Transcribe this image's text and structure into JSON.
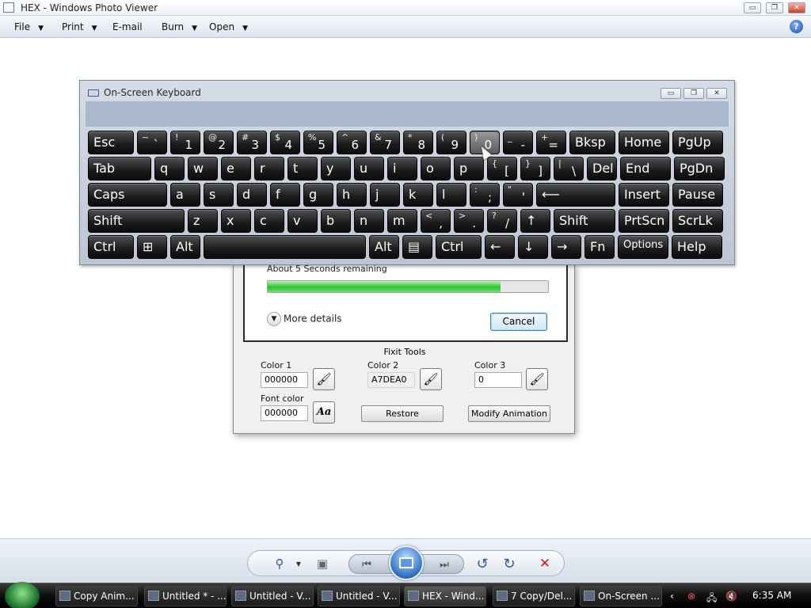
{
  "photo_viewer": {
    "title": "HEX - Windows Photo Viewer",
    "window_buttons": [
      "▭",
      "❐",
      "✕"
    ],
    "menu": [
      {
        "label": "File",
        "has_arrow": true
      },
      {
        "label": "Print",
        "has_arrow": true
      },
      {
        "label": "E-mail",
        "has_arrow": false
      },
      {
        "label": "Burn",
        "has_arrow": true
      },
      {
        "label": "Open",
        "has_arrow": true
      }
    ],
    "help": "?",
    "controls": {
      "zoom_icon": "⚲",
      "actual_size_icon": "▣",
      "prev_icon": "⏮",
      "next_icon": "⏭",
      "rotate_ccw_icon": "↺",
      "rotate_cw_icon": "↻",
      "delete_icon": "✕"
    }
  },
  "progress_dialog": {
    "remaining_text": "About 5 Seconds remaining",
    "progress": 0.83,
    "more_details": "More details",
    "cancel": "Cancel"
  },
  "fixit": {
    "title": "Fixit Tools",
    "color1_label": "Color 1",
    "color1_value": "000000",
    "color2_label": "Color 2",
    "color2_value": "A7DEA0",
    "color3_label": "Color 3",
    "color3_value": "0",
    "font_color_label": "Font color",
    "font_color_value": "000000",
    "font_button": "Aa",
    "restore": "Restore",
    "modify_animation": "Modify Animation"
  },
  "osk": {
    "title": "On-Screen Keyboard",
    "window_buttons": [
      "▭",
      "❐",
      "✕"
    ],
    "rows": [
      [
        {
          "m": "Esc"
        },
        {
          "s": "~",
          "b": "`"
        },
        {
          "s": "!",
          "b": "1"
        },
        {
          "s": "@",
          "b": "2"
        },
        {
          "s": "#",
          "b": "3"
        },
        {
          "s": "$",
          "b": "4"
        },
        {
          "s": "%",
          "b": "5"
        },
        {
          "s": "^",
          "b": "6"
        },
        {
          "s": "&",
          "b": "7"
        },
        {
          "s": "*",
          "b": "8"
        },
        {
          "s": "(",
          "b": "9"
        },
        {
          "s": ")",
          "b": "0",
          "sel": true
        },
        {
          "s": "_",
          "b": "-"
        },
        {
          "s": "+",
          "b": "="
        },
        {
          "m": "Bksp"
        },
        {
          "m": "Home"
        },
        {
          "m": "PgUp"
        }
      ],
      [
        {
          "m": "Tab"
        },
        {
          "m": "q"
        },
        {
          "m": "w"
        },
        {
          "m": "e"
        },
        {
          "m": "r"
        },
        {
          "m": "t"
        },
        {
          "m": "y"
        },
        {
          "m": "u"
        },
        {
          "m": "i"
        },
        {
          "m": "o"
        },
        {
          "m": "p"
        },
        {
          "s": "{",
          "b": "["
        },
        {
          "s": "}",
          "b": "]"
        },
        {
          "s": "|",
          "b": "\\"
        },
        {
          "m": "Del"
        },
        {
          "m": "End"
        },
        {
          "m": "PgDn"
        }
      ],
      [
        {
          "m": "Caps"
        },
        {
          "m": "a"
        },
        {
          "m": "s"
        },
        {
          "m": "d"
        },
        {
          "m": "f"
        },
        {
          "m": "g"
        },
        {
          "m": "h"
        },
        {
          "m": "j"
        },
        {
          "m": "k"
        },
        {
          "m": "l"
        },
        {
          "s": ":",
          "b": ";"
        },
        {
          "s": "\"",
          "b": "'"
        },
        {
          "m": "⟵"
        },
        {
          "m": "Insert"
        },
        {
          "m": "Pause"
        }
      ],
      [
        {
          "m": "Shift"
        },
        {
          "m": "z"
        },
        {
          "m": "x"
        },
        {
          "m": "c"
        },
        {
          "m": "v"
        },
        {
          "m": "b"
        },
        {
          "m": "n"
        },
        {
          "m": "m"
        },
        {
          "s": "<",
          "b": ","
        },
        {
          "s": ">",
          "b": "."
        },
        {
          "s": "?",
          "b": "/"
        },
        {
          "m": "↑"
        },
        {
          "m": "Shift"
        },
        {
          "m": "PrtScn"
        },
        {
          "m": "ScrLk"
        }
      ],
      [
        {
          "m": "Ctrl"
        },
        {
          "m": "⊞"
        },
        {
          "m": "Alt"
        },
        {
          "m": ""
        },
        {
          "m": "Alt"
        },
        {
          "m": "▤"
        },
        {
          "m": "Ctrl"
        },
        {
          "m": "←"
        },
        {
          "m": "↓"
        },
        {
          "m": "→"
        },
        {
          "m": "Fn"
        },
        {
          "m": "Options",
          "small": true
        },
        {
          "m": "Help"
        }
      ]
    ]
  },
  "taskbar": {
    "items": [
      {
        "label": "Copy Anim...",
        "active": false
      },
      {
        "label": "Untitled * - ...",
        "active": false
      },
      {
        "label": "Untitled - V...",
        "active": false
      },
      {
        "label": "Untitled - V...",
        "active": false
      },
      {
        "label": "HEX - Wind...",
        "active": true
      },
      {
        "label": "7 Copy/Del...",
        "active": false
      },
      {
        "label": "On-Screen ...",
        "active": false
      }
    ],
    "tray_icons": [
      "‹",
      "⊗",
      "🖧",
      "🔇"
    ],
    "clock": "6:35 AM"
  }
}
